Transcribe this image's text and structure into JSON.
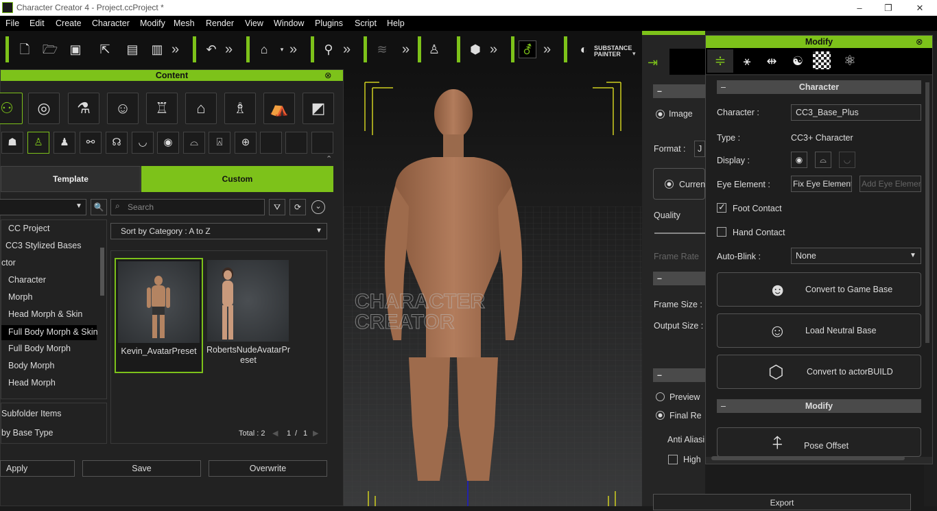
{
  "window": {
    "title": "Character Creator 4 - Project.ccProject *",
    "min": "–",
    "max": "❐",
    "close": "✕"
  },
  "menu": [
    "File",
    "Edit",
    "Create",
    "Character",
    "Modify",
    "Mesh",
    "Render",
    "View",
    "Window",
    "Plugins",
    "Script",
    "Help"
  ],
  "toolbar": {
    "substance": "SUBSTANCE",
    "painter": "PAINTER",
    "more": "»"
  },
  "content": {
    "title": "Content",
    "tab_template": "Template",
    "tab_custom": "Custom",
    "search_placeholder": "Search",
    "sort": "Sort by Category : A to Z",
    "tree": [
      "CC Project",
      "CC3 Stylized Bases",
      "ctor",
      "Character",
      "Morph",
      "Head Morph & Skin",
      "Full Body Morph & Skin",
      "Full Body Morph",
      "Body Morph",
      "Head Morph"
    ],
    "subfolder": "Subfolder Items",
    "base_type": "by Base Type",
    "items": [
      {
        "name": "Kevin_AvatarPreset"
      },
      {
        "name": "RobertsNudeAvatarPr",
        "name2": "eset"
      }
    ],
    "total": "Total : 2",
    "page": "1",
    "slash": "/",
    "pages": "1",
    "apply": "Apply",
    "save": "Save",
    "overwrite": "Overwrite"
  },
  "viewport": {
    "watermark1": "CHARACTER",
    "watermark2": "CREATOR"
  },
  "render_panel": {
    "image": "Image",
    "format": "Format :",
    "format_val": "J",
    "current": "Curren",
    "quality": "Quality",
    "frame_rate": "Frame Rate",
    "frame_size": "Frame Size :",
    "output_size": "Output Size :",
    "preview": "Preview",
    "final": "Final Re",
    "anti": "Anti Aliasi",
    "high": "High",
    "export": "Export",
    "collapse": "–"
  },
  "modify": {
    "title": "Modify",
    "section_character": "Character",
    "character_label": "Character :",
    "character_value": "CC3_Base_Plus",
    "type_label": "Type :",
    "type_value": "CC3+ Character",
    "display_label": "Display :",
    "eye_label": "Eye Element :",
    "eye_fix": "Fix Eye Element",
    "eye_add": "Add Eye Elemen",
    "foot_contact": "Foot Contact",
    "hand_contact": "Hand Contact",
    "autoblink_label": "Auto-Blink :",
    "autoblink_value": "None",
    "convert_game": "Convert to Game Base",
    "load_neutral": "Load Neutral Base",
    "convert_actor": "Convert to actorBUILD",
    "section_modify": "Modify",
    "pose_offset": "Pose Offset",
    "collapse": "–"
  },
  "colors": {
    "accent": "#7dc21a"
  }
}
